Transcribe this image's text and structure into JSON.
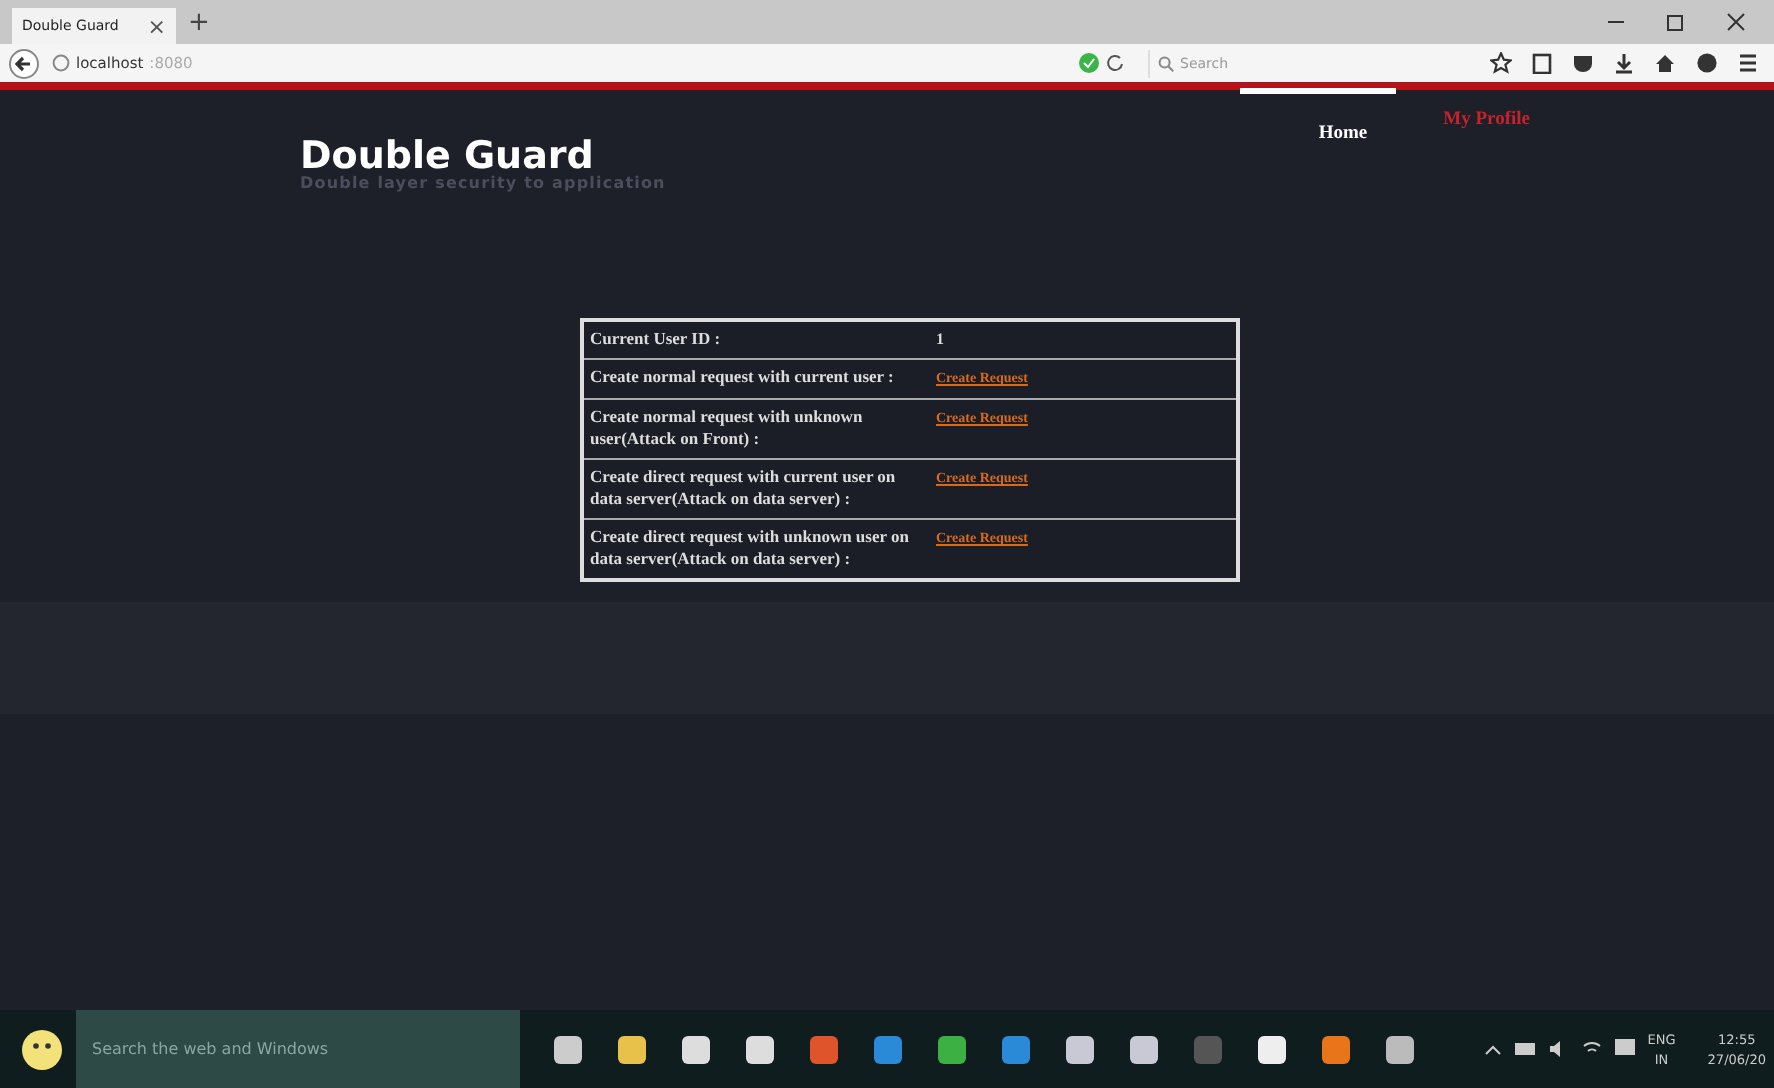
{
  "browser": {
    "tab": {
      "title": "Double Guard",
      "close": "×",
      "new_tab": "+"
    },
    "url": {
      "host": "localhost",
      "port": ":8080"
    },
    "search": {
      "placeholder": "Search"
    }
  },
  "site": {
    "title": "Double Guard",
    "subtitle": "Double layer security to application",
    "nav": [
      {
        "label": "Home",
        "selected": true
      },
      {
        "label": "My Profile",
        "selected": false
      }
    ]
  },
  "table": {
    "rows": [
      {
        "label": "Current User ID :",
        "kind": "text",
        "value": "1"
      },
      {
        "label": "Create normal request with current user :",
        "kind": "link",
        "value": "Create Request"
      },
      {
        "label": "Create normal request with unknown user(Attack on Front) :",
        "kind": "link",
        "value": "Create Request"
      },
      {
        "label": "Create direct request with current user on data server(Attack on data server) :",
        "kind": "link",
        "value": "Create Request"
      },
      {
        "label": "Create direct request with unknown user on data server(Attack on data server) :",
        "kind": "link",
        "value": "Create Request"
      }
    ]
  },
  "taskbar": {
    "search": {
      "placeholder": "Search the web and Windows"
    },
    "language": "ENG",
    "region": "IN",
    "time": "12:55",
    "date": "27/06/20"
  }
}
